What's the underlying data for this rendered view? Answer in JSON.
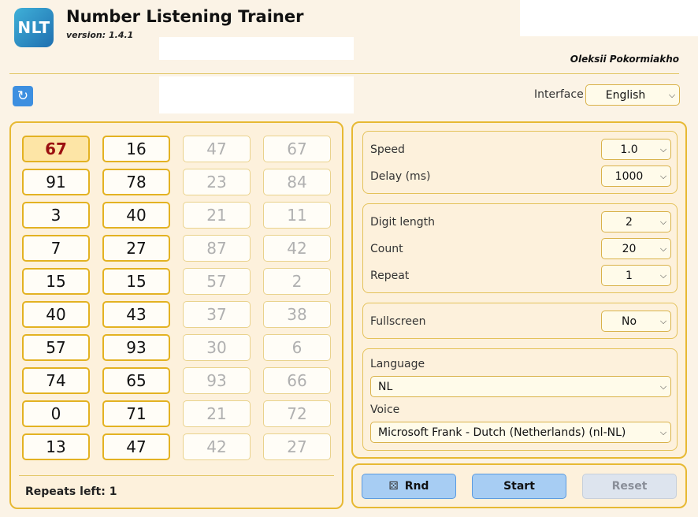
{
  "app": {
    "logo_text": "NLT",
    "title": "Number Listening Trainer",
    "version": "version: 1.4.1",
    "author": "Oleksii Pokormiakho"
  },
  "toolbar": {
    "refresh_icon": "refresh-icon",
    "interface_label": "Interface",
    "interface_value": "English"
  },
  "numbers": {
    "columns": [
      [
        "67",
        "91",
        "3",
        "7",
        "15",
        "40",
        "57",
        "74",
        "0",
        "13"
      ],
      [
        "16",
        "78",
        "40",
        "27",
        "15",
        "43",
        "93",
        "65",
        "71",
        "47"
      ],
      [
        "47",
        "23",
        "21",
        "87",
        "57",
        "37",
        "30",
        "93",
        "21",
        "42"
      ],
      [
        "67",
        "84",
        "11",
        "42",
        "2",
        "38",
        "6",
        "66",
        "72",
        "27"
      ]
    ],
    "current": "67",
    "repeats_left": "Repeats left: 1"
  },
  "settings": {
    "speed_label": "Speed",
    "speed_value": "1.0",
    "delay_label": "Delay (ms)",
    "delay_value": "1000",
    "digit_length_label": "Digit length",
    "digit_length_value": "2",
    "count_label": "Count",
    "count_value": "20",
    "repeat_label": "Repeat",
    "repeat_value": "1",
    "fullscreen_label": "Fullscreen",
    "fullscreen_value": "No",
    "language_label": "Language",
    "language_value": "NL",
    "voice_label": "Voice",
    "voice_value": "Microsoft Frank - Dutch (Netherlands) (nl-NL)"
  },
  "actions": {
    "rnd_label": "Rnd",
    "start_label": "Start",
    "reset_label": "Reset"
  }
}
